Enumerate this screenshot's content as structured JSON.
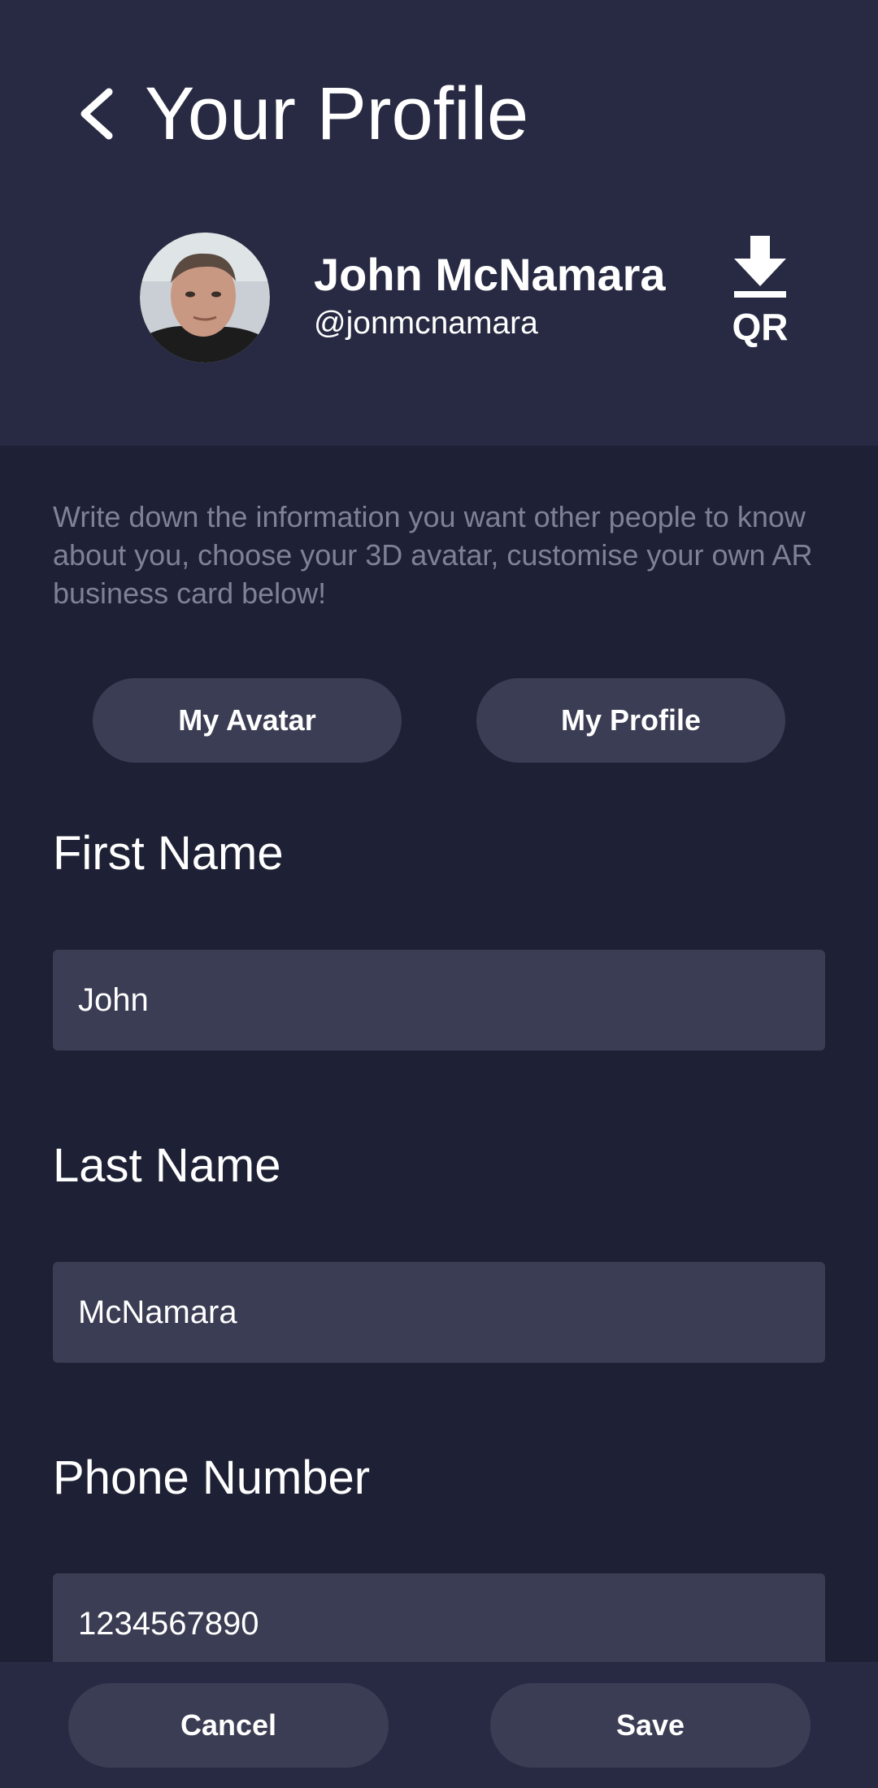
{
  "header": {
    "title": "Your Profile",
    "back_icon": "chevron-left-icon"
  },
  "profile": {
    "name": "John McNamara",
    "handle": "@jonmcnamara",
    "qr_label": "QR",
    "qr_icon": "download-icon"
  },
  "intro_text": "Write down the information you want other people to know about you, choose your 3D avatar, customise your own AR business card below!",
  "tabs": [
    {
      "label": "My Avatar"
    },
    {
      "label": "My Profile"
    }
  ],
  "form": {
    "first_name": {
      "label": "First Name",
      "value": "John"
    },
    "last_name": {
      "label": "Last Name",
      "value": "McNamara"
    },
    "phone": {
      "label": "Phone Number",
      "value": "1234567890"
    }
  },
  "footer": {
    "cancel_label": "Cancel",
    "save_label": "Save"
  },
  "colors": {
    "background": "#1e2135",
    "header_background": "#272a42",
    "control_background": "#3a3d53",
    "muted_text": "#7f8296",
    "text": "#ffffff"
  }
}
